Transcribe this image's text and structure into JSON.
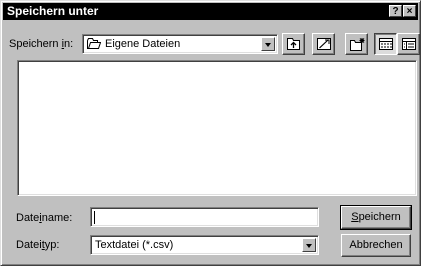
{
  "window": {
    "title": "Speichern unter",
    "help_label": "?",
    "close_label": "×"
  },
  "save_in": {
    "label_pre": "Speichern ",
    "label_accel": "i",
    "label_post": "n:",
    "folder": "Eigene Dateien",
    "folder_icon": "open-folder-icon"
  },
  "toolbar": {
    "icons": [
      "up-one-level-icon",
      "new-folder-icon",
      "desktop-icon",
      "list-view-icon",
      "details-view-icon"
    ],
    "active": "list-view-icon"
  },
  "file_list": {
    "items": []
  },
  "file_name": {
    "label_pre": "Date",
    "label_accel": "i",
    "label_post": "name:",
    "value": ""
  },
  "file_type": {
    "label_pre": "Datei",
    "label_accel": "t",
    "label_post": "yp:",
    "value": "Textdatei (*.csv)"
  },
  "buttons": {
    "save_accel": "S",
    "save_rest": "peichern",
    "cancel": "Abbrechen"
  },
  "colors": {
    "face": "#c0c0c0",
    "titlebar": "#000000",
    "field": "#ffffff"
  }
}
